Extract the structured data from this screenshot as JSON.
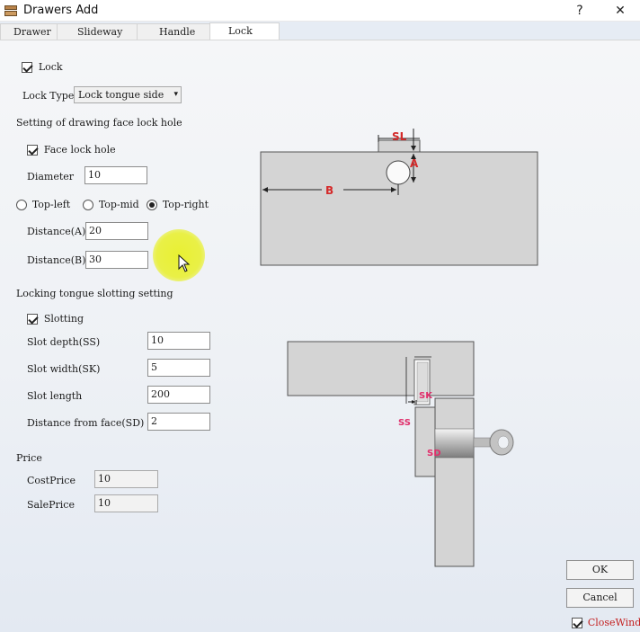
{
  "window": {
    "title": "Drawers Add",
    "help": "?",
    "close": "✕"
  },
  "tabs": [
    "Drawer",
    "Slideway",
    "Handle",
    "Lock"
  ],
  "lock": {
    "checkbox_label": "Lock",
    "lock_type_label": "Lock Type",
    "lock_type_value": "Lock tongue side"
  },
  "face_hole": {
    "section_title": "Setting of drawing face lock hole",
    "checkbox_label": "Face lock hole",
    "diameter_label": "Diameter",
    "diameter_value": "10",
    "positions": [
      "Top-left",
      "Top-mid",
      "Top-right"
    ],
    "selected_position": "Top-right",
    "distance_a_label": "Distance(A)",
    "distance_a_value": "20",
    "distance_b_label": "Distance(B)",
    "distance_b_value": "30"
  },
  "slotting": {
    "section_title": "Locking tongue slotting setting",
    "checkbox_label": "Slotting",
    "slot_depth_label": "Slot depth(SS)",
    "slot_depth_value": "10",
    "slot_width_label": "Slot width(SK)",
    "slot_width_value": "5",
    "slot_length_label": "Slot length",
    "slot_length_value": "200",
    "distance_face_label": "Distance from face(SD)",
    "distance_face_value": "2"
  },
  "price": {
    "section_title": "Price",
    "cost_label": "CostPrice",
    "cost_value": "10",
    "sale_label": "SalePrice",
    "sale_value": "10"
  },
  "diagram": {
    "sl": "SL",
    "a": "A",
    "b": "B",
    "sk": "SK",
    "ss": "SS",
    "sd": "SD"
  },
  "buttons": {
    "ok": "OK",
    "cancel": "Cancel",
    "close_window": "CloseWindo"
  },
  "colors": {
    "accent_red": "#d42a2a",
    "accent_pink": "#e02f6b",
    "highlight_yellow": "#e8f028"
  }
}
